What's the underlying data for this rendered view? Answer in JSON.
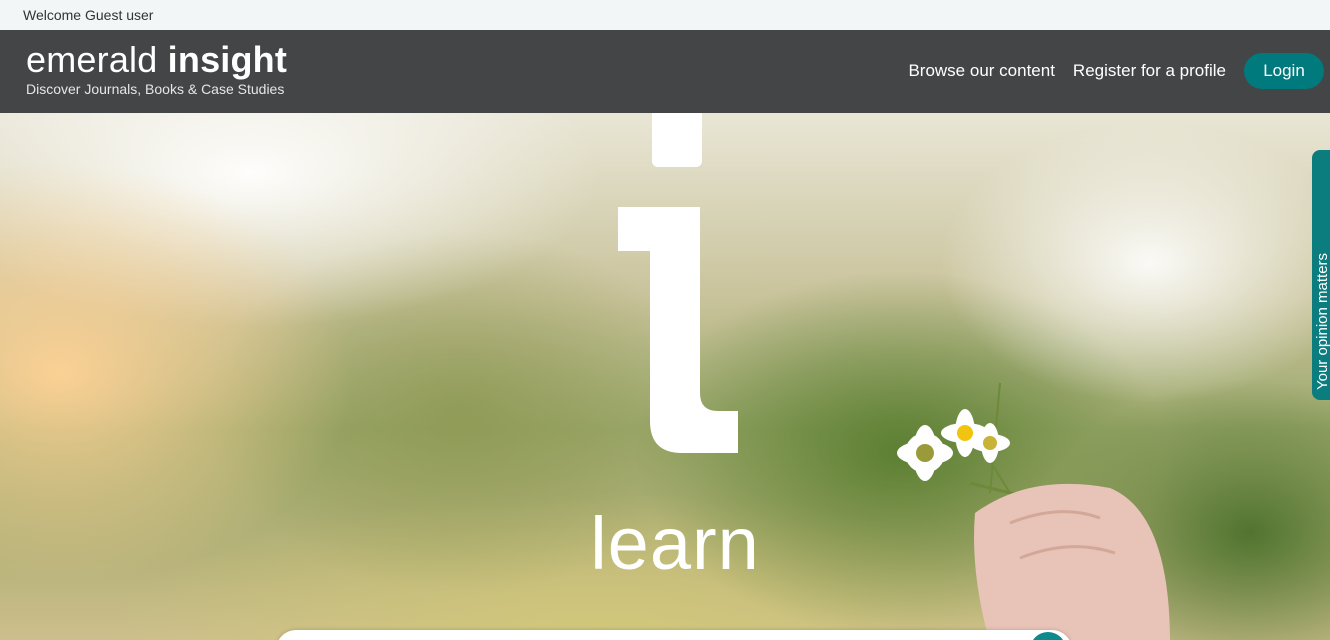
{
  "topbar": {
    "welcome": "Welcome Guest user"
  },
  "header": {
    "brand": {
      "light": "emerald ",
      "bold": "insight",
      "tagline": "Discover Journals, Books & Case Studies"
    },
    "nav": {
      "browse": "Browse our content",
      "register": "Register for a profile",
      "login": "Login"
    }
  },
  "hero": {
    "word": "learn",
    "feedback_tab": "Your opinion matters"
  },
  "colors": {
    "header_bg": "#434547",
    "accent": "#007a7c",
    "topbar_bg": "#f3f6f6"
  }
}
